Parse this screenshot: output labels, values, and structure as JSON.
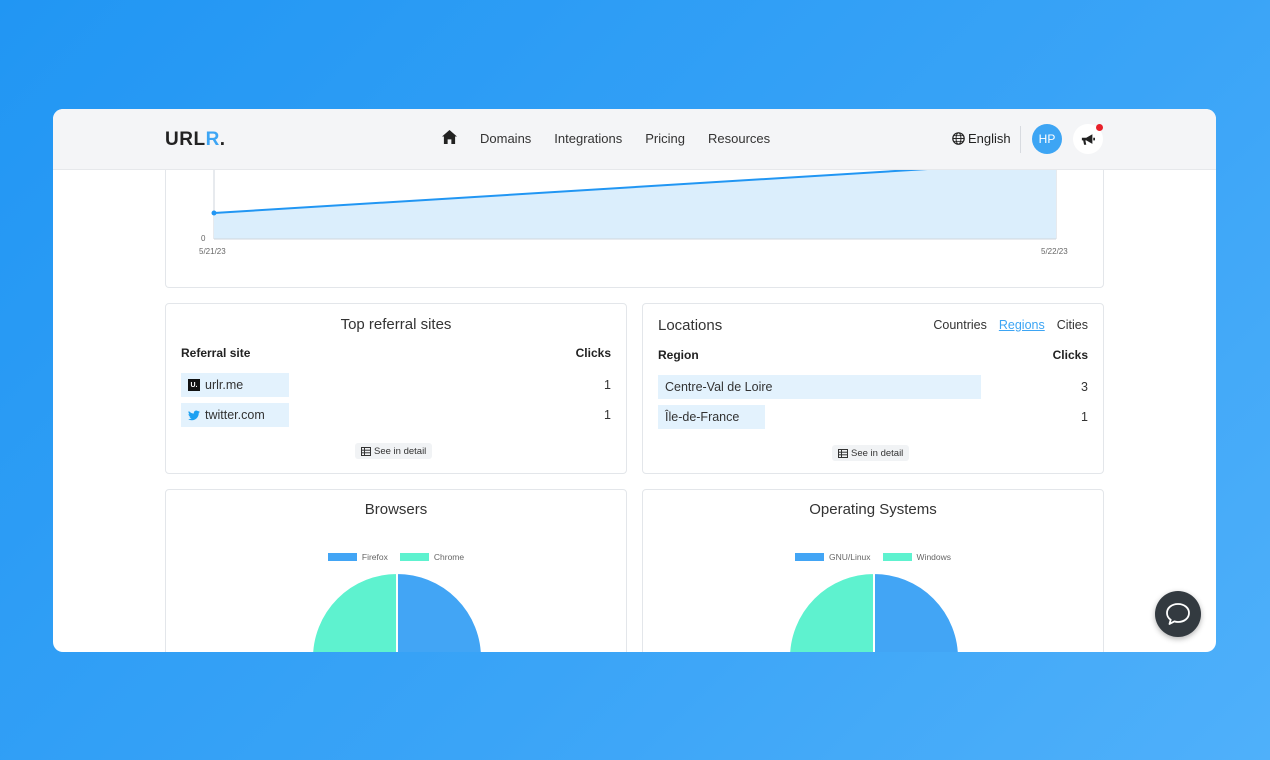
{
  "brand": {
    "logo_main": "URL",
    "logo_accent": "R",
    "logo_dot": "."
  },
  "nav": {
    "links": [
      "Domains",
      "Integrations",
      "Pricing",
      "Resources"
    ],
    "language": "English",
    "avatar_initials": "HP"
  },
  "timeline": {
    "chart_data": {
      "type": "area",
      "x": [
        "5/21/23",
        "5/22/23"
      ],
      "y_tick_labels": [
        "0"
      ],
      "series": [
        {
          "values": [
            1,
            3
          ]
        }
      ],
      "ylim": [
        0,
        3.85
      ],
      "grid": false,
      "color": "#2196f3",
      "fill": "#dbeefc"
    }
  },
  "referrals": {
    "title": "Top referral sites",
    "col_site": "Referral site",
    "col_clicks": "Clicks",
    "rows": [
      {
        "site": "urlr.me",
        "clicks": "1",
        "icon": "urlr-logo-icon"
      },
      {
        "site": "twitter.com",
        "clicks": "1",
        "icon": "twitter-icon"
      }
    ],
    "detail_button": "See in detail"
  },
  "locations": {
    "title": "Locations",
    "tabs": [
      "Countries",
      "Regions",
      "Cities"
    ],
    "active_tab": "Regions",
    "col_region": "Region",
    "col_clicks": "Clicks",
    "rows": [
      {
        "region": "Centre-Val de Loire",
        "clicks": "3",
        "share": 1.0
      },
      {
        "region": "Île-de-France",
        "clicks": "1",
        "share": 0.33
      }
    ],
    "detail_button": "See in detail"
  },
  "browsers": {
    "title": "Browsers",
    "chart_data": {
      "type": "pie",
      "labels": [
        "Firefox",
        "Chrome"
      ],
      "values": [
        1,
        1
      ],
      "colors": [
        "#42a5f5",
        "#5ef2cf"
      ],
      "legend": "top"
    }
  },
  "os": {
    "title": "Operating Systems",
    "chart_data": {
      "type": "pie",
      "labels": [
        "GNU/Linux",
        "Windows"
      ],
      "values": [
        1,
        1
      ],
      "colors": [
        "#42a5f5",
        "#5ef2cf"
      ],
      "legend": "top"
    }
  }
}
